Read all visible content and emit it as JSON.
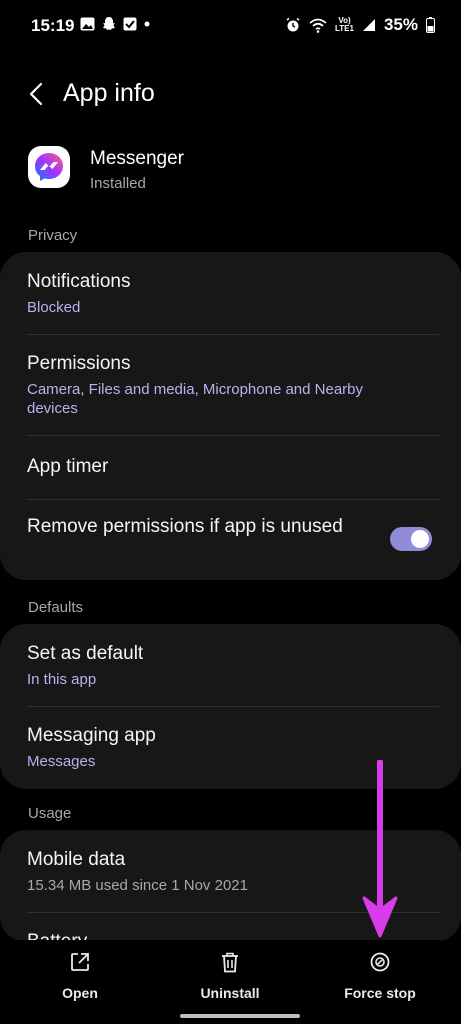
{
  "status": {
    "time": "15:19",
    "battery": "35%",
    "network_label_1": "Vo)",
    "network_label_2": "LTE1"
  },
  "header": {
    "title": "App info"
  },
  "app": {
    "name": "Messenger",
    "status": "Installed"
  },
  "sections": {
    "privacy": "Privacy",
    "defaults": "Defaults",
    "usage": "Usage"
  },
  "privacy_items": [
    {
      "title": "Notifications",
      "sub": "Blocked"
    },
    {
      "title": "Permissions",
      "sub": "Camera, Files and media, Microphone and Nearby devices"
    },
    {
      "title": "App timer"
    },
    {
      "title": "Remove permissions if app is unused",
      "toggle_on": true
    }
  ],
  "defaults_items": [
    {
      "title": "Set as default",
      "sub": "In this app"
    },
    {
      "title": "Messaging app",
      "sub": "Messages"
    }
  ],
  "usage_items": [
    {
      "title": "Mobile data",
      "sub": "15.34 MB used since 1 Nov 2021"
    },
    {
      "title": "Battery"
    }
  ],
  "bottom_actions": {
    "open": "Open",
    "uninstall": "Uninstall",
    "force_stop": "Force stop"
  },
  "colors": {
    "accent": "#b7b3f0",
    "toggle": "#8f8bd6",
    "card": "#171717",
    "annotation_arrow": "#d63ce8"
  }
}
